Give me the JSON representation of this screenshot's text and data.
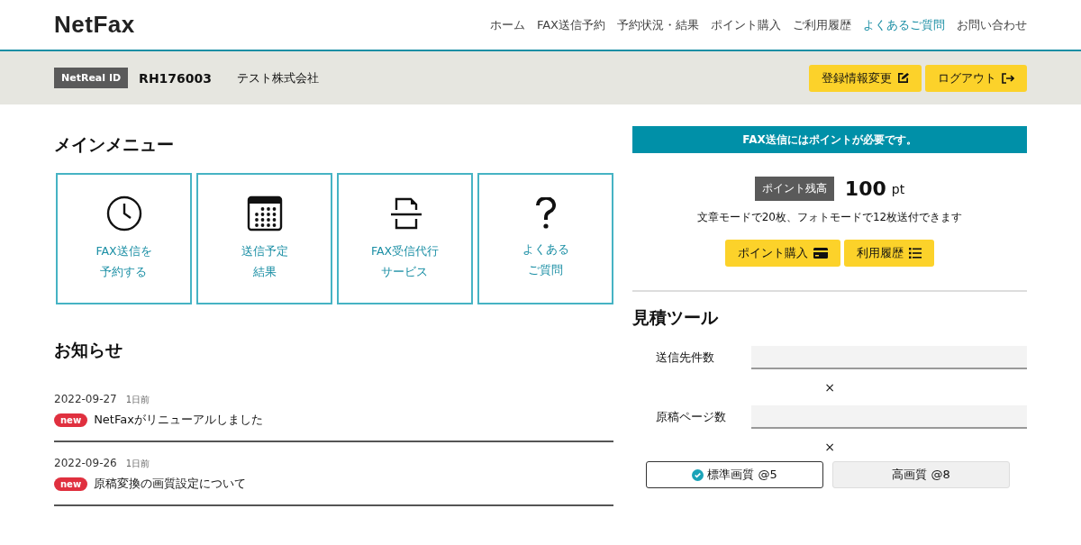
{
  "header": {
    "logo": "NetFax",
    "nav": [
      {
        "label": "ホーム",
        "selected": false
      },
      {
        "label": "FAX送信予約",
        "selected": false
      },
      {
        "label": "予約状況・結果",
        "selected": false
      },
      {
        "label": "ポイント購入",
        "selected": false
      },
      {
        "label": "ご利用履歴",
        "selected": false
      },
      {
        "label": "よくあるご質問",
        "selected": true
      },
      {
        "label": "お問い合わせ",
        "selected": false
      }
    ]
  },
  "account_bar": {
    "id_label": "NetReal ID",
    "id_value": "RH176003",
    "company": "テスト株式会社",
    "buttons": [
      {
        "label": "登録情報変更",
        "kind": "edit"
      },
      {
        "label": "ログアウト",
        "kind": "logout"
      }
    ]
  },
  "main_menu": {
    "title": "メインメニュー",
    "items": [
      {
        "kind": "clock",
        "lines": [
          "FAX送信を",
          "予約する"
        ]
      },
      {
        "kind": "calendar",
        "lines": [
          "送信予定",
          "結果"
        ]
      },
      {
        "kind": "scan",
        "lines": [
          "FAX受信代行",
          "サービス"
        ]
      },
      {
        "kind": "question",
        "lines": [
          "よくある",
          "ご質問"
        ]
      }
    ]
  },
  "news": {
    "title": "お知らせ",
    "items": [
      {
        "date": "2022-09-27",
        "ago": "1日前",
        "badge": "new",
        "title": "NetFaxがリニューアルしました"
      },
      {
        "date": "2022-09-26",
        "ago": "1日前",
        "badge": "new",
        "title": "原稿変換の画質設定について"
      }
    ]
  },
  "points": {
    "banner": "FAX送信にはポイントが必要です。",
    "balance_label": "ポイント残高",
    "balance": "100",
    "unit": "pt",
    "note": "文章モードで20枚、フォトモードで12枚送付できます",
    "buttons": [
      {
        "label": "ポイント購入",
        "kind": "card"
      },
      {
        "label": "利用履歴",
        "kind": "list"
      }
    ]
  },
  "estimate": {
    "title": "見積ツール",
    "fields": [
      {
        "label": "送信先件数",
        "times": "×"
      },
      {
        "label": "原稿ページ数",
        "times": "×"
      }
    ],
    "quality": [
      {
        "label": "標準画質 @5",
        "selected": true
      },
      {
        "label": "高画質 @8",
        "selected": false
      }
    ]
  }
}
